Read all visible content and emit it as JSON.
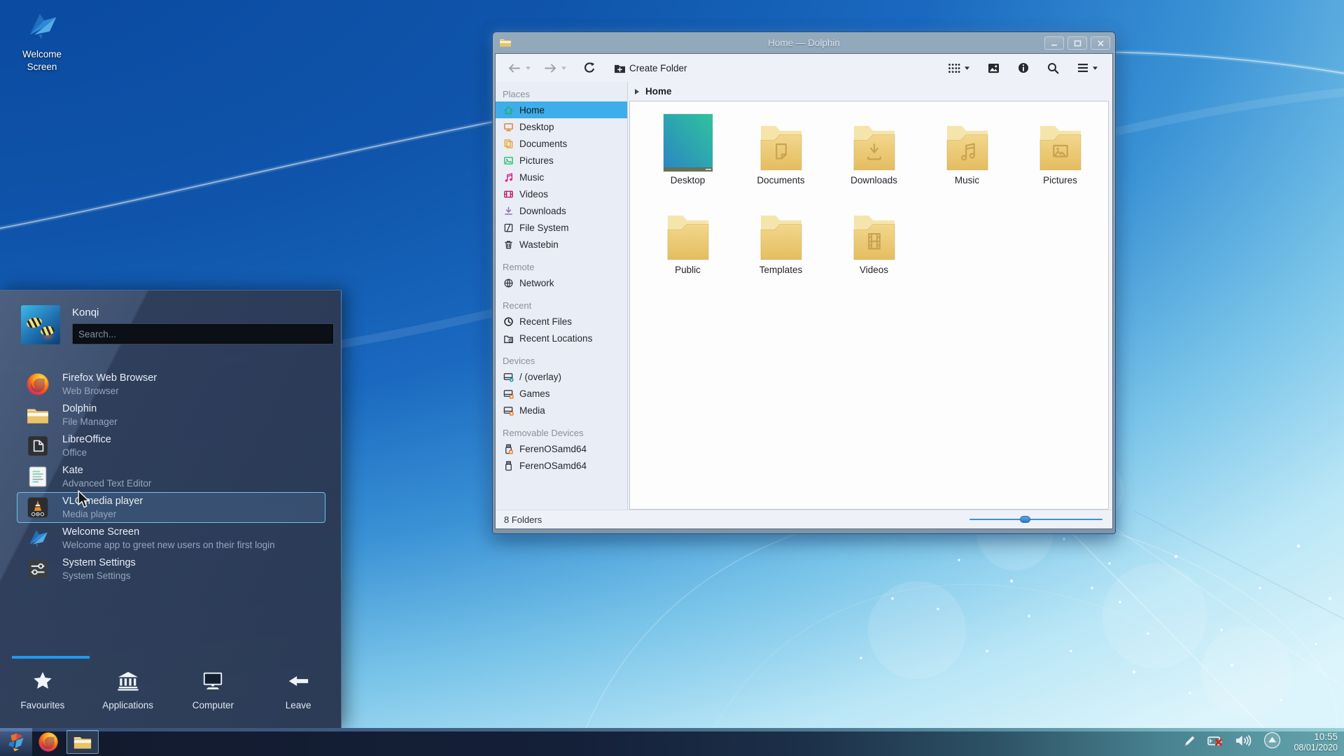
{
  "desktop": {
    "welcome_icon_label": "Welcome Screen"
  },
  "launcher": {
    "username": "Konqi",
    "search_placeholder": "Search...",
    "apps": [
      {
        "name": "Firefox Web Browser",
        "description": "Web Browser",
        "icon": "firefox-icon",
        "highlighted": false
      },
      {
        "name": "Dolphin",
        "description": "File Manager",
        "icon": "dolphin-folder-icon",
        "highlighted": false
      },
      {
        "name": "LibreOffice",
        "description": "Office",
        "icon": "libreoffice-icon",
        "highlighted": false
      },
      {
        "name": "Kate",
        "description": "Advanced Text Editor",
        "icon": "kate-icon",
        "highlighted": false
      },
      {
        "name": "VLC media player",
        "description": "Media player",
        "icon": "vlc-icon",
        "highlighted": true
      },
      {
        "name": "Welcome Screen",
        "description": "Welcome app to greet new users on their first login",
        "icon": "welcome-bird-icon",
        "highlighted": false
      },
      {
        "name": "System Settings",
        "description": "System Settings",
        "icon": "system-settings-icon",
        "highlighted": false
      }
    ],
    "tabs": [
      {
        "label": "Favourites",
        "icon": "star-icon",
        "active": true
      },
      {
        "label": "Applications",
        "icon": "applications-icon",
        "active": false
      },
      {
        "label": "Computer",
        "icon": "computer-icon",
        "active": false
      },
      {
        "label": "Leave",
        "icon": "leave-icon",
        "active": false
      }
    ]
  },
  "dolphin": {
    "title": "Home — Dolphin",
    "toolbar": {
      "create_folder_label": "Create Folder"
    },
    "breadcrumb": "Home",
    "places": {
      "sections": [
        {
          "title": "Places",
          "items": [
            {
              "label": "Home",
              "icon": "home-icon",
              "selected": true
            },
            {
              "label": "Desktop",
              "icon": "desktop-icon",
              "selected": false
            },
            {
              "label": "Documents",
              "icon": "documents-icon",
              "selected": false
            },
            {
              "label": "Pictures",
              "icon": "pictures-icon",
              "selected": false
            },
            {
              "label": "Music",
              "icon": "music-icon",
              "selected": false
            },
            {
              "label": "Videos",
              "icon": "videos-icon",
              "selected": false
            },
            {
              "label": "Downloads",
              "icon": "downloads-icon",
              "selected": false
            },
            {
              "label": "File System",
              "icon": "filesystem-icon",
              "selected": false
            },
            {
              "label": "Wastebin",
              "icon": "wastebin-icon",
              "selected": false
            }
          ]
        },
        {
          "title": "Remote",
          "items": [
            {
              "label": "Network",
              "icon": "network-icon",
              "selected": false
            }
          ]
        },
        {
          "title": "Recent",
          "items": [
            {
              "label": "Recent Files",
              "icon": "recent-files-icon",
              "selected": false
            },
            {
              "label": "Recent Locations",
              "icon": "recent-locations-icon",
              "selected": false
            }
          ]
        },
        {
          "title": "Devices",
          "items": [
            {
              "label": "/ (overlay)",
              "icon": "drive-overlay-icon",
              "selected": false
            },
            {
              "label": "Games",
              "icon": "drive-games-icon",
              "selected": false
            },
            {
              "label": "Media",
              "icon": "drive-media-icon",
              "selected": false
            }
          ]
        },
        {
          "title": "Removable Devices",
          "items": [
            {
              "label": "FerenOSamd64",
              "icon": "usb-drive-icon",
              "selected": false
            },
            {
              "label": "FerenOSamd64",
              "icon": "usb-drive-plain-icon",
              "selected": false
            }
          ]
        }
      ]
    },
    "folders": [
      {
        "label": "Desktop",
        "glyph": "wallpaper"
      },
      {
        "label": "Documents",
        "glyph": "document"
      },
      {
        "label": "Downloads",
        "glyph": "download"
      },
      {
        "label": "Music",
        "glyph": "music"
      },
      {
        "label": "Pictures",
        "glyph": "picture"
      },
      {
        "label": "Public",
        "glyph": "none"
      },
      {
        "label": "Templates",
        "glyph": "none"
      },
      {
        "label": "Videos",
        "glyph": "video"
      }
    ],
    "status": "8 Folders"
  },
  "taskbar": {
    "clock": {
      "time": "10:55",
      "date": "08/01/2020"
    }
  },
  "colors": {
    "accent": "#3daee9",
    "tab_indicator": "#1d99f3",
    "folder_yellow": "#eec96e",
    "titlebar": "#89a0b3"
  }
}
